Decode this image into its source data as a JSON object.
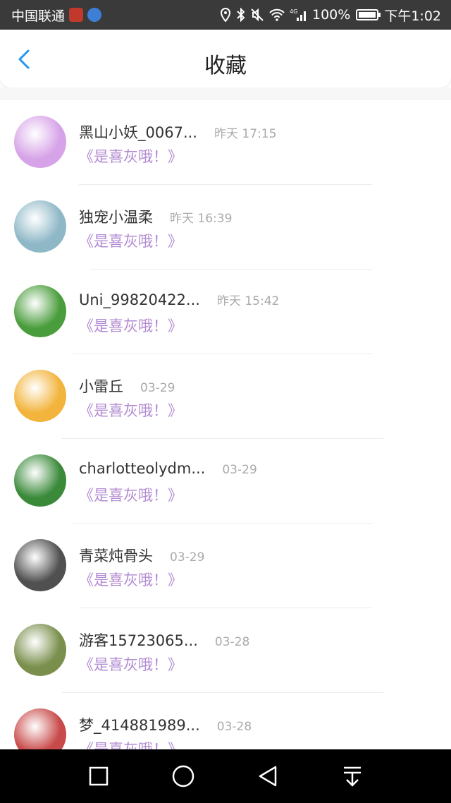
{
  "status_bar": {
    "carrier": "中国联通",
    "network": "4G",
    "battery": "100%",
    "time": "下午1:02"
  },
  "header": {
    "title": "收藏"
  },
  "items": [
    {
      "name": "黑山小妖_0067...",
      "time": "昨天 17:15",
      "favorite": "《是喜灰哦！》",
      "avatar_color": "#d7a3e8"
    },
    {
      "name": "独宠小温柔",
      "time": "昨天 16:39",
      "favorite": "《是喜灰哦！》",
      "avatar_color": "#8fb8c7"
    },
    {
      "name": "Uni_99820422...",
      "time": "昨天 15:42",
      "favorite": "《是喜灰哦！》",
      "avatar_color": "#4a9d3c"
    },
    {
      "name": "小雷丘",
      "time": "03-29",
      "favorite": "《是喜灰哦！》",
      "avatar_color": "#f2b43c"
    },
    {
      "name": "charlotteolydm...",
      "time": "03-29",
      "favorite": "《是喜灰哦！》",
      "avatar_color": "#3b8a3a"
    },
    {
      "name": "青菜炖骨头",
      "time": "03-29",
      "favorite": "《是喜灰哦！》",
      "avatar_color": "#505050"
    },
    {
      "name": "游客15723065...",
      "time": "03-28",
      "favorite": "《是喜灰哦！》",
      "avatar_color": "#7a8f4c"
    },
    {
      "name": "梦_414881989...",
      "time": "03-28",
      "favorite": "《是喜灰哦！》",
      "avatar_color": "#c94a4a"
    }
  ],
  "colors": {
    "accent": "#2196f3",
    "favorite_text": "#b28ad2"
  },
  "icons": {
    "back": "chevron-left-icon",
    "nav": [
      "recent-apps-icon",
      "home-icon",
      "back-icon",
      "notification-pull-icon"
    ]
  }
}
